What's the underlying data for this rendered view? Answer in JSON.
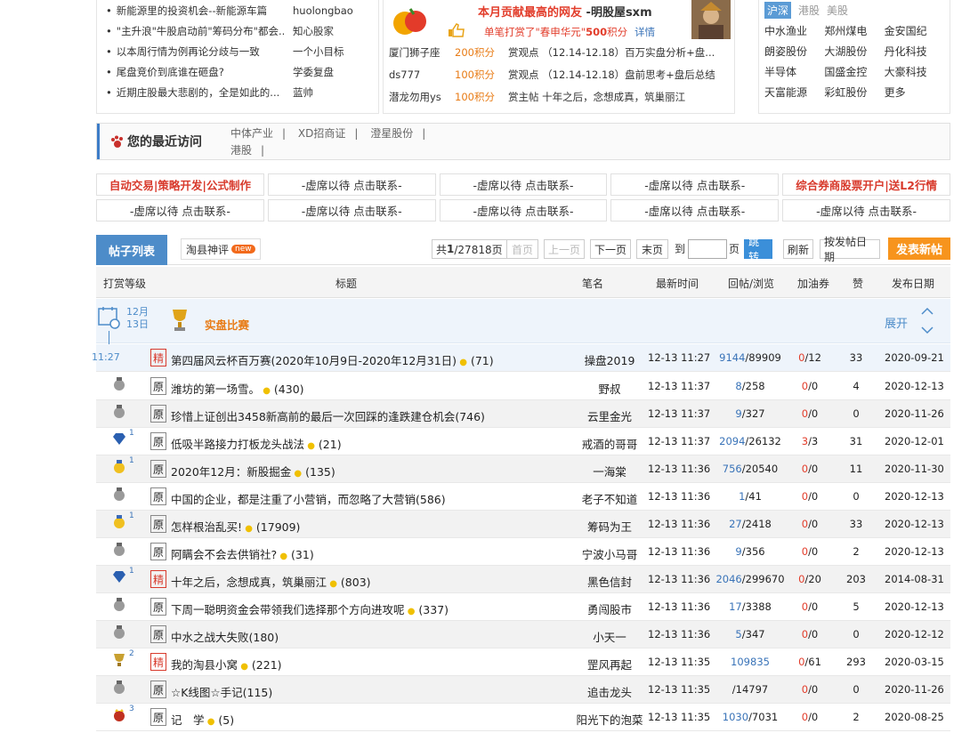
{
  "news": [
    {
      "title": "新能源里的投资机会--新能源车篇",
      "author": "huolongbao"
    },
    {
      "title": "\"主升浪\"牛股启动前\"筹码分布\"都会...",
      "author": "知心股家"
    },
    {
      "title": "以本周行情为例再论分歧与一致",
      "author": "一个小目标"
    },
    {
      "title": "尾盘竞价到底谁在砸盘?",
      "author": "学委复盘"
    },
    {
      "title": "近期庄股最大悲剧的，全是如此的...",
      "author": "蓝帅"
    }
  ],
  "award": {
    "title": "本月贡献最高的网友",
    "user": "-明股屋sxm",
    "sub_prefix": "单笔打赏了\"春申华元\"",
    "sub_points": "500",
    "sub_suffix": "积分",
    "detail": "详情",
    "rows": [
      {
        "user": "厦门狮子座",
        "points": "200积分",
        "desc": "赏观点 （12.14-12.18）百万实盘分析+盘..."
      },
      {
        "user": "ds777",
        "points": "100积分",
        "desc": "赏观点 （12.14-12.18）盘前思考+盘后总结"
      },
      {
        "user": "潜龙勿用ys",
        "points": "100积分",
        "desc": "赏主帖 十年之后，念想成真，筑巢丽江"
      }
    ]
  },
  "stocks": {
    "tabs": [
      "沪深",
      "港股",
      "美股"
    ],
    "items": [
      "中水渔业",
      "郑州煤电",
      "金安国纪",
      "朗姿股份",
      "大湖股份",
      "丹化科技",
      "半导体",
      "国盛金控",
      "大豪科技",
      "天富能源",
      "彩虹股份",
      "更多"
    ]
  },
  "recent": {
    "label": "您的最近访问",
    "links": [
      "中体产业",
      "XD招商证",
      "澄星股份",
      "港股"
    ]
  },
  "ads": [
    [
      "自动交易|策略开发|公式制作",
      "-虚席以待 点击联系-",
      "-虚席以待 点击联系-",
      "-虚席以待 点击联系-",
      "综合券商股票开户|送L2行情"
    ],
    [
      "-虚席以待 点击联系-",
      "-虚席以待 点击联系-",
      "-虚席以待 点击联系-",
      "-虚席以待 点击联系-",
      "-虚席以待 点击联系-"
    ]
  ],
  "toolbar": {
    "tab_active": "帖子列表",
    "tab2": "淘县神评",
    "new_badge": "new",
    "total_prefix": "共",
    "page_current": "1",
    "page_total": "/27818页",
    "first": "首页",
    "prev": "上一页",
    "next": "下一页",
    "last": "末页",
    "goto_prefix": "到",
    "goto_suffix": "页",
    "jump": "跳转",
    "refresh": "刷新",
    "by_date": "按发帖日期",
    "post_new": "发表新帖"
  },
  "table": {
    "headers": [
      "打赏等级",
      "标题",
      "笔名",
      "最新时间",
      "回帖/浏览",
      "加油券",
      "赞",
      "发布日期"
    ],
    "section": {
      "month": "12月",
      "day": "13日",
      "title": "实盘比赛",
      "expand": "展开"
    },
    "rows": [
      {
        "tag": "精",
        "title": "第四届风云杯百万赛(2020年10月9日-2020年12月31日)",
        "count": "(71)",
        "author": "操盘2019",
        "time": "12-13 11:27",
        "replies": "9144",
        "views": "/89909",
        "jy1": "0",
        "jy2": "/12",
        "zan": "33",
        "date": "2020-09-21",
        "time_marker": "11:27"
      },
      {
        "tag": "原",
        "title": "潍坊的第一场雪。",
        "count": "(430)",
        "author": "野叔",
        "time": "12-13 11:37",
        "replies": "8",
        "views": "/258",
        "jy1": "0",
        "jy2": "/0",
        "zan": "4",
        "date": "2020-12-13"
      },
      {
        "tag": "原",
        "title": "珍惜上证创出3458新高前的最后一次回踩的逢跌建仓机会(746)",
        "count": "",
        "author": "云里金光",
        "time": "12-13 11:37",
        "replies": "9",
        "views": "/327",
        "jy1": "0",
        "jy2": "/0",
        "zan": "0",
        "date": "2020-11-26"
      },
      {
        "tag": "原",
        "title": "低吸半路接力打板龙头战法",
        "count": "(21)",
        "author": "戒酒的哥哥",
        "time": "12-13 11:37",
        "replies": "2094",
        "views": "/26132",
        "jy1": "3",
        "jy2": "/3",
        "zan": "31",
        "date": "2020-12-01",
        "level": "1"
      },
      {
        "tag": "原",
        "title": "2020年12月：新股掘金",
        "count": "(135)",
        "author": "一海棠",
        "time": "12-13 11:36",
        "replies": "756",
        "views": "/20540",
        "jy1": "0",
        "jy2": "/0",
        "zan": "11",
        "date": "2020-11-30",
        "level": "1"
      },
      {
        "tag": "原",
        "title": "中国的企业，都是注重了小营销，而忽略了大营销(586)",
        "count": "",
        "author": "老子不知道",
        "time": "12-13 11:36",
        "replies": "1",
        "views": "/41",
        "jy1": "0",
        "jy2": "/0",
        "zan": "0",
        "date": "2020-12-13"
      },
      {
        "tag": "原",
        "title": "怎样根治乱买!",
        "count": "(17909)",
        "author": "筹码为王",
        "time": "12-13 11:36",
        "replies": "27",
        "views": "/2418",
        "jy1": "0",
        "jy2": "/0",
        "zan": "33",
        "date": "2020-12-13",
        "level": "1"
      },
      {
        "tag": "原",
        "title": "阿瞒会不会去供销社?",
        "count": "(31)",
        "author": "宁波小马哥",
        "time": "12-13 11:36",
        "replies": "9",
        "views": "/356",
        "jy1": "0",
        "jy2": "/0",
        "zan": "2",
        "date": "2020-12-13"
      },
      {
        "tag": "精",
        "title": "十年之后，念想成真，筑巢丽江",
        "count": "(803)",
        "author": "黑色信封",
        "time": "12-13 11:36",
        "replies": "2046",
        "views": "/299670",
        "jy1": "0",
        "jy2": "/20",
        "zan": "203",
        "date": "2014-08-31",
        "level": "1"
      },
      {
        "tag": "原",
        "title": "下周一聪明资金会带领我们选择那个方向进攻呢",
        "count": "(337)",
        "author": "勇闯股市",
        "time": "12-13 11:36",
        "replies": "17",
        "views": "/3388",
        "jy1": "0",
        "jy2": "/0",
        "zan": "5",
        "date": "2020-12-13"
      },
      {
        "tag": "原",
        "title": "中水之战大失败(180)",
        "count": "",
        "author": "小天一",
        "time": "12-13 11:36",
        "replies": "5",
        "views": "/347",
        "jy1": "0",
        "jy2": "/0",
        "zan": "0",
        "date": "2020-12-12"
      },
      {
        "tag": "精",
        "title": "我的淘县小窝",
        "count": "(221)",
        "author": "罡风再起",
        "time": "12-13 11:35",
        "replies": "109835",
        "views": "",
        "jy1": "0",
        "jy2": "/61",
        "zan": "293",
        "date": "2020-03-15",
        "level": "2"
      },
      {
        "tag": "原",
        "title": "☆K线图☆手记(115)",
        "count": "",
        "author": "追击龙头",
        "time": "12-13 11:35",
        "replies": "",
        "views": "/14797",
        "jy1": "0",
        "jy2": "/0",
        "zan": "0",
        "date": "2020-11-26"
      },
      {
        "tag": "原",
        "title": "记　学",
        "count": "(5)",
        "author": "阳光下的泡菜",
        "time": "12-13 11:35",
        "replies": "1030",
        "views": "/7031",
        "jy1": "0",
        "jy2": "/0",
        "zan": "2",
        "date": "2020-08-25",
        "level": "3"
      }
    ]
  },
  "colors": {
    "accent": "#4d8cc9",
    "red": "#d83a2c",
    "orange": "#f7941d"
  }
}
